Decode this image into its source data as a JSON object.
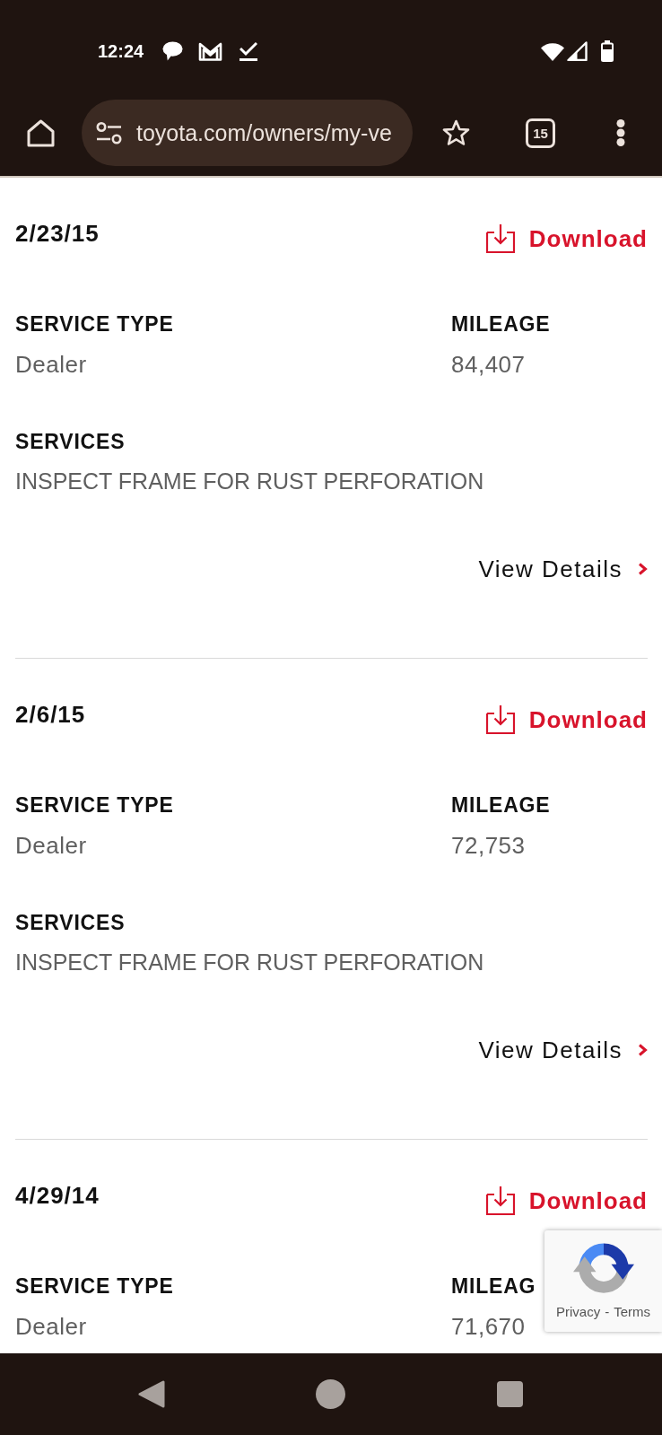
{
  "status_bar": {
    "time": "12:24"
  },
  "browser": {
    "url": "toyota.com/owners/my-ve",
    "tab_count": "15"
  },
  "records": [
    {
      "date": "2/23/15",
      "download": "Download",
      "fields": [
        {
          "label": "SERVICE TYPE",
          "value": "Dealer"
        },
        {
          "label": "MILEAGE",
          "value": "84,407"
        }
      ],
      "services": {
        "label": "SERVICES",
        "value": "INSPECT FRAME FOR RUST PERFORATION"
      },
      "details_link": "View Details"
    },
    {
      "date": "2/6/15",
      "download": "Download",
      "fields": [
        {
          "label": "SERVICE TYPE",
          "value": "Dealer"
        },
        {
          "label": "MILEAGE",
          "value": "72,753"
        }
      ],
      "services": {
        "label": "SERVICES",
        "value": "INSPECT FRAME FOR RUST PERFORATION"
      },
      "details_link": "View Details"
    },
    {
      "date": "4/29/14",
      "download": "Download",
      "fields": [
        {
          "label": "SERVICE TYPE",
          "value": "Dealer"
        },
        {
          "label": "MILEAG",
          "value": "71,670"
        }
      ]
    }
  ],
  "captcha_badge": {
    "links": [
      "Privacy",
      "Terms"
    ],
    "separator": "-"
  }
}
